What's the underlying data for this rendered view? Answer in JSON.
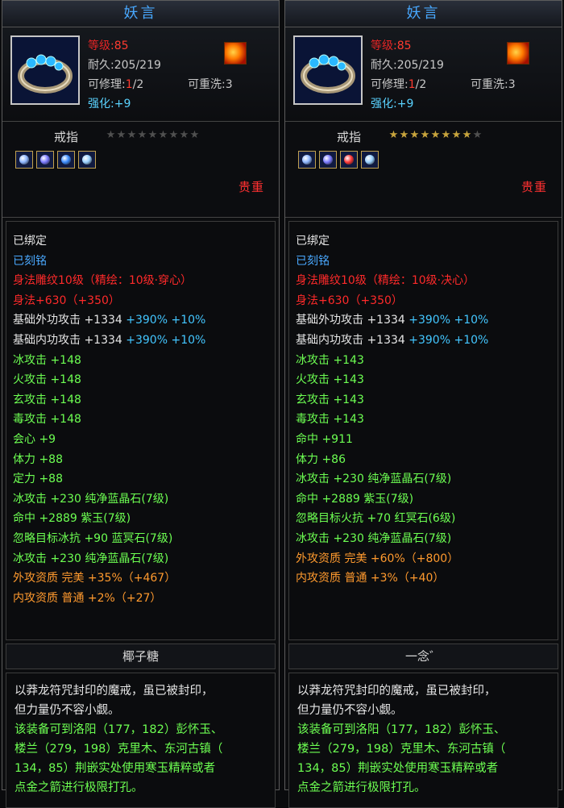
{
  "panels": [
    {
      "title": "妖言",
      "level_label": "等级",
      "level_value": "85",
      "durability_label": "耐久",
      "durability_value": "205/219",
      "repair_label": "可修理",
      "repair_used": "1",
      "repair_total": "/2",
      "reset_label": "可重洗",
      "reset_value": "3",
      "enhance_label": "强化",
      "enhance_value": "+9",
      "item_type": "戒指",
      "stars_total": 9,
      "stars_filled": 0,
      "gems": [
        "#8fb6ff",
        "#7b7bff",
        "#3c8cff",
        "#9ad0ff"
      ],
      "rarity": "贵重",
      "attributes": [
        {
          "text": "已绑定",
          "color": "#e6e6e6"
        },
        {
          "text": "已刻铭",
          "color": "#4aa9ff"
        },
        {
          "text": "身法雕纹10级（精绘：10级·穿心）",
          "color": "#ff2a2a"
        },
        {
          "text": "身法+630（+350）",
          "color": "#ff2a2a"
        },
        {
          "segments": [
            {
              "text": "基础外功攻击 +1334 ",
              "color": "#e6e6e6"
            },
            {
              "text": "+390% +10%",
              "color": "#43c6ff"
            }
          ]
        },
        {
          "segments": [
            {
              "text": "基础内功攻击 +1334 ",
              "color": "#e6e6e6"
            },
            {
              "text": "+390% +10%",
              "color": "#43c6ff"
            }
          ]
        },
        {
          "text": "冰攻击 +148",
          "color": "#6dff52"
        },
        {
          "text": "火攻击 +148",
          "color": "#6dff52"
        },
        {
          "text": "玄攻击 +148",
          "color": "#6dff52"
        },
        {
          "text": "毒攻击 +148",
          "color": "#6dff52"
        },
        {
          "text": "会心 +9",
          "color": "#6dff52"
        },
        {
          "text": "体力 +88",
          "color": "#6dff52"
        },
        {
          "text": "定力 +88",
          "color": "#6dff52"
        },
        {
          "text": "冰攻击 +230 纯净蓝晶石(7级)",
          "color": "#6dff52"
        },
        {
          "text": "命中 +2889 紫玉(7级)",
          "color": "#6dff52"
        },
        {
          "text": "忽略目标冰抗 +90 蓝冥石(7级)",
          "color": "#6dff52"
        },
        {
          "text": "冰攻击 +230 纯净蓝晶石(7级)",
          "color": "#6dff52"
        },
        {
          "text": "外攻资质  完美 +35%（+467）",
          "color": "#ff9a2e"
        },
        {
          "text": "内攻资质  普通 +2%（+27）",
          "color": "#ff9a2e"
        }
      ],
      "owner": "椰子糖",
      "description": [
        {
          "text": "以莽龙符咒封印的魔戒，虽已被封印，",
          "color": "#e6e6e6"
        },
        {
          "text": "但力量仍不容小觑。",
          "color": "#e6e6e6"
        },
        {
          "text": "该装备可到洛阳（177，182）彭怀玉、",
          "color": "#6dff52"
        },
        {
          "text": "楼兰（279，198）克里木、东河古镇（",
          "color": "#6dff52"
        },
        {
          "text": "134，85）荆嵌实处使用寒玉精粹或者",
          "color": "#6dff52"
        },
        {
          "text": "点金之箭进行极限打孔。",
          "color": "#6dff52"
        }
      ]
    },
    {
      "title": "妖言",
      "level_label": "等级",
      "level_value": "85",
      "durability_label": "耐久",
      "durability_value": "205/219",
      "repair_label": "可修理",
      "repair_used": "1",
      "repair_total": "/2",
      "reset_label": "可重洗",
      "reset_value": "3",
      "enhance_label": "强化",
      "enhance_value": "+9",
      "item_type": "戒指",
      "stars_total": 9,
      "stars_filled": 8,
      "gems": [
        "#8fb6ff",
        "#7b7bff",
        "#ff3a3a",
        "#9ad0ff"
      ],
      "rarity": "贵重",
      "attributes": [
        {
          "text": "已绑定",
          "color": "#e6e6e6"
        },
        {
          "text": "已刻铭",
          "color": "#4aa9ff"
        },
        {
          "text": "身法雕纹10级（精绘：10级·决心）",
          "color": "#ff2a2a"
        },
        {
          "text": "身法+630（+350）",
          "color": "#ff2a2a"
        },
        {
          "segments": [
            {
              "text": "基础外功攻击 +1334 ",
              "color": "#e6e6e6"
            },
            {
              "text": "+390% +10%",
              "color": "#43c6ff"
            }
          ]
        },
        {
          "segments": [
            {
              "text": "基础内功攻击 +1334 ",
              "color": "#e6e6e6"
            },
            {
              "text": "+390% +10%",
              "color": "#43c6ff"
            }
          ]
        },
        {
          "text": "冰攻击 +143",
          "color": "#6dff52"
        },
        {
          "text": "火攻击 +143",
          "color": "#6dff52"
        },
        {
          "text": "玄攻击 +143",
          "color": "#6dff52"
        },
        {
          "text": "毒攻击 +143",
          "color": "#6dff52"
        },
        {
          "text": "命中 +911",
          "color": "#6dff52"
        },
        {
          "text": "体力 +86",
          "color": "#6dff52"
        },
        {
          "text": "冰攻击 +230 纯净蓝晶石(7级)",
          "color": "#6dff52"
        },
        {
          "text": "命中 +2889 紫玉(7级)",
          "color": "#6dff52"
        },
        {
          "text": "忽略目标火抗 +70 红冥石(6级)",
          "color": "#6dff52"
        },
        {
          "text": "冰攻击 +230 纯净蓝晶石(7级)",
          "color": "#6dff52"
        },
        {
          "text": "外攻资质  完美 +60%（+800）",
          "color": "#ff9a2e"
        },
        {
          "text": "内攻资质  普通 +3%（+40）",
          "color": "#ff9a2e"
        }
      ],
      "owner": "一念゛",
      "description": [
        {
          "text": "以莽龙符咒封印的魔戒，虽已被封印，",
          "color": "#e6e6e6"
        },
        {
          "text": "但力量仍不容小觑。",
          "color": "#e6e6e6"
        },
        {
          "text": "该装备可到洛阳（177，182）彭怀玉、",
          "color": "#6dff52"
        },
        {
          "text": "楼兰（279，198）克里木、东河古镇（",
          "color": "#6dff52"
        },
        {
          "text": "134，85）荆嵌实处使用寒玉精粹或者",
          "color": "#6dff52"
        },
        {
          "text": "点金之箭进行极限打孔。",
          "color": "#6dff52"
        }
      ]
    }
  ]
}
